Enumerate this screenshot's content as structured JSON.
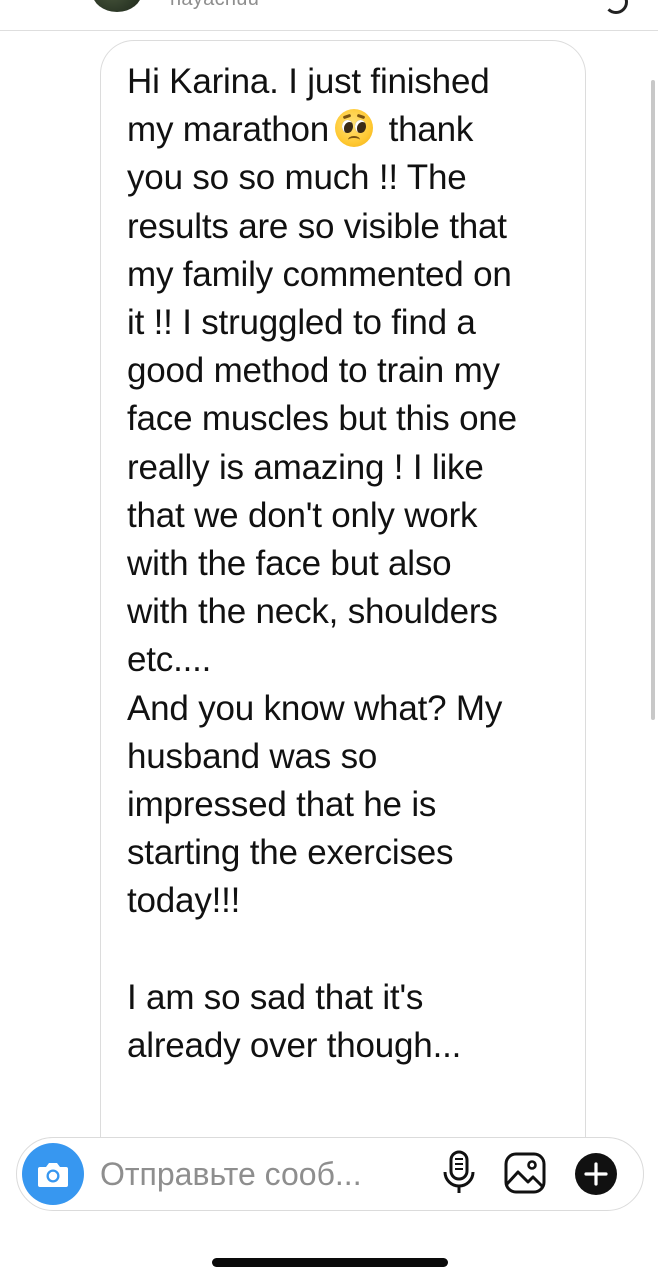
{
  "header": {
    "username": "hayachuu",
    "avatar_icon": "avatar-image",
    "menu_icon": "more-icon"
  },
  "message": {
    "text_before_emoji": "Hi Karina. I just finished\nmy marathon",
    "emoji": "pleading-face-emoji",
    "text_after_emoji": " thank\nyou so so much !! The\nresults are so visible that\nmy family commented on\nit !! I struggled to find a\ngood method to train my\nface muscles but this one\nreally is amazing ! I like\nthat we don't only work\nwith the face but also\nwith the neck, shoulders\netc....\nAnd you know what? My\nhusband was so\nimpressed that he is\nstarting the exercises\ntoday!!!\n\nI am so sad that it's\nalready over though..."
  },
  "composer": {
    "placeholder": "Отправьте сооб...",
    "camera_icon": "camera-icon",
    "mic_icon": "microphone-icon",
    "gallery_icon": "gallery-icon",
    "add_icon": "plus-icon"
  },
  "colors": {
    "accent": "#3797f0",
    "placeholder": "#8e8e8e",
    "bubble_border": "#dcdcdc"
  }
}
